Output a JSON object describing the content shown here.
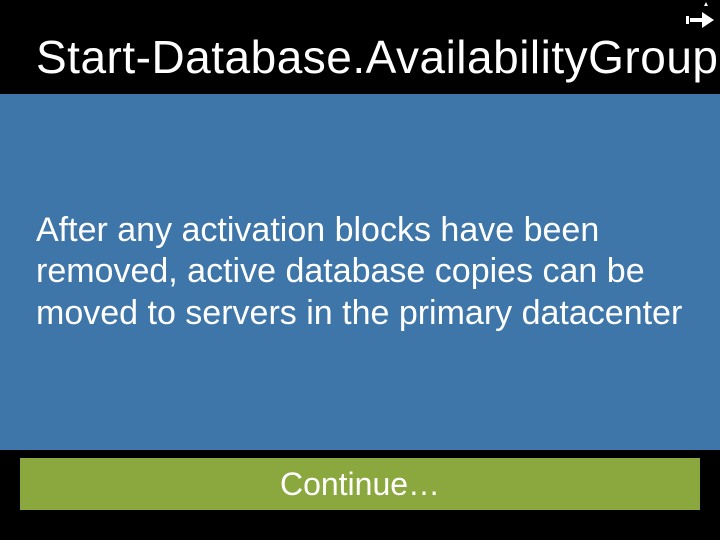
{
  "slide": {
    "title": "Start-Database.AvailabilityGroup",
    "body": "After any activation blocks have been removed, active database copies can be moved to servers in the primary datacenter",
    "continue_label": "Continue…",
    "icon": "pointer-hand-icon"
  },
  "colors": {
    "background": "#000000",
    "panel": "#3f76a9",
    "continue_bar": "#8ba83f",
    "text": "#ffffff"
  }
}
